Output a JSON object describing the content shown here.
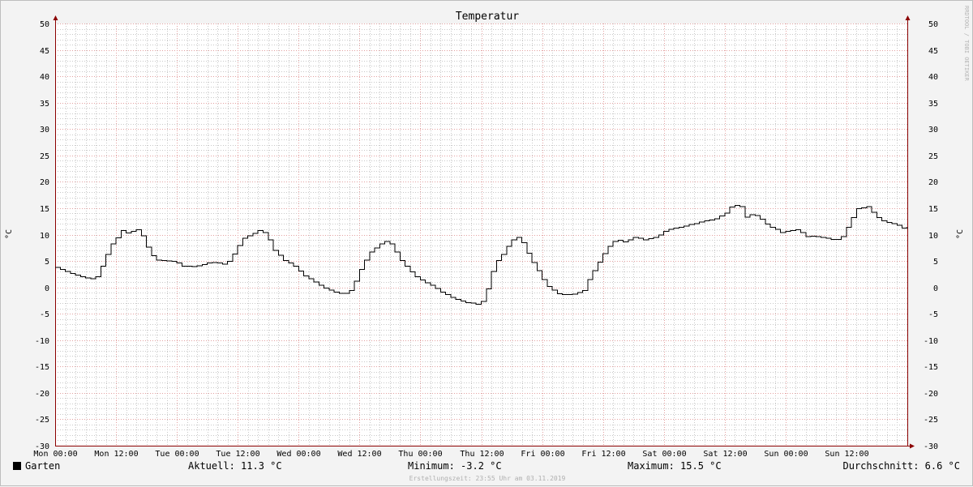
{
  "chart_data": {
    "type": "line",
    "title": "Temperatur",
    "ylabel": "°C",
    "ylabel_right": "°C",
    "watermark": "RRDTOOL / TOBI OETIKER",
    "ylim": [
      -30,
      50
    ],
    "yticks": [
      50,
      45,
      40,
      35,
      30,
      25,
      20,
      15,
      10,
      5,
      0,
      -5,
      -10,
      -15,
      -20,
      -25,
      -30
    ],
    "xlim_hours": [
      0,
      168
    ],
    "xticks": [
      {
        "label": "Mon 00:00",
        "hour": 0
      },
      {
        "label": "Mon 12:00",
        "hour": 12
      },
      {
        "label": "Tue 00:00",
        "hour": 24
      },
      {
        "label": "Tue 12:00",
        "hour": 36
      },
      {
        "label": "Wed 00:00",
        "hour": 48
      },
      {
        "label": "Wed 12:00",
        "hour": 60
      },
      {
        "label": "Thu 00:00",
        "hour": 72
      },
      {
        "label": "Thu 12:00",
        "hour": 84
      },
      {
        "label": "Fri 00:00",
        "hour": 96
      },
      {
        "label": "Fri 12:00",
        "hour": 108
      },
      {
        "label": "Sat 00:00",
        "hour": 120
      },
      {
        "label": "Sat 12:00",
        "hour": 132
      },
      {
        "label": "Sun 00:00",
        "hour": 144
      },
      {
        "label": "Sun 12:00",
        "hour": 156
      }
    ],
    "grid": true,
    "series": [
      {
        "name": "Garten",
        "color": "#000000",
        "points": [
          [
            0,
            3.8
          ],
          [
            1,
            3.4
          ],
          [
            2,
            3.0
          ],
          [
            3,
            2.6
          ],
          [
            4,
            2.3
          ],
          [
            5,
            2.0
          ],
          [
            6,
            1.8
          ],
          [
            7,
            1.6
          ],
          [
            8,
            2.0
          ],
          [
            9,
            4.0
          ],
          [
            10,
            6.2
          ],
          [
            11,
            8.2
          ],
          [
            12,
            9.4
          ],
          [
            13,
            10.8
          ],
          [
            14,
            10.3
          ],
          [
            15,
            10.6
          ],
          [
            16,
            10.9
          ],
          [
            17,
            9.8
          ],
          [
            18,
            7.6
          ],
          [
            19,
            6.0
          ],
          [
            20,
            5.2
          ],
          [
            21,
            5.1
          ],
          [
            22,
            5.0
          ],
          [
            23,
            4.9
          ],
          [
            24,
            4.6
          ],
          [
            25,
            4.0
          ],
          [
            26,
            4.0
          ],
          [
            27,
            3.9
          ],
          [
            28,
            4.1
          ],
          [
            29,
            4.3
          ],
          [
            30,
            4.6
          ],
          [
            31,
            4.7
          ],
          [
            32,
            4.6
          ],
          [
            33,
            4.4
          ],
          [
            34,
            4.9
          ],
          [
            35,
            6.3
          ],
          [
            36,
            7.9
          ],
          [
            37,
            9.3
          ],
          [
            38,
            9.8
          ],
          [
            39,
            10.2
          ],
          [
            40,
            10.8
          ],
          [
            41,
            10.4
          ],
          [
            42,
            9.0
          ],
          [
            43,
            7.0
          ],
          [
            44,
            6.1
          ],
          [
            45,
            5.1
          ],
          [
            46,
            4.6
          ],
          [
            47,
            4.0
          ],
          [
            48,
            3.1
          ],
          [
            49,
            2.2
          ],
          [
            50,
            1.6
          ],
          [
            51,
            1.0
          ],
          [
            52,
            0.4
          ],
          [
            53,
            -0.1
          ],
          [
            54,
            -0.5
          ],
          [
            55,
            -0.9
          ],
          [
            56,
            -1.1
          ],
          [
            57,
            -1.1
          ],
          [
            58,
            -0.6
          ],
          [
            59,
            1.2
          ],
          [
            60,
            3.4
          ],
          [
            61,
            5.2
          ],
          [
            62,
            6.7
          ],
          [
            63,
            7.5
          ],
          [
            64,
            8.2
          ],
          [
            65,
            8.7
          ],
          [
            66,
            8.2
          ],
          [
            67,
            6.7
          ],
          [
            68,
            5.1
          ],
          [
            69,
            4.0
          ],
          [
            70,
            2.9
          ],
          [
            71,
            2.0
          ],
          [
            72,
            1.4
          ],
          [
            73,
            0.9
          ],
          [
            74,
            0.4
          ],
          [
            75,
            -0.2
          ],
          [
            76,
            -0.9
          ],
          [
            77,
            -1.4
          ],
          [
            78,
            -1.9
          ],
          [
            79,
            -2.3
          ],
          [
            80,
            -2.6
          ],
          [
            81,
            -2.9
          ],
          [
            82,
            -3.0
          ],
          [
            83,
            -3.2
          ],
          [
            84,
            -2.7
          ],
          [
            85,
            -0.3
          ],
          [
            86,
            3.0
          ],
          [
            87,
            5.1
          ],
          [
            88,
            6.2
          ],
          [
            89,
            7.8
          ],
          [
            90,
            9.0
          ],
          [
            91,
            9.5
          ],
          [
            92,
            8.5
          ],
          [
            93,
            6.5
          ],
          [
            94,
            4.7
          ],
          [
            95,
            3.2
          ],
          [
            96,
            1.5
          ],
          [
            97,
            0.2
          ],
          [
            98,
            -0.5
          ],
          [
            99,
            -1.2
          ],
          [
            100,
            -1.4
          ],
          [
            101,
            -1.4
          ],
          [
            102,
            -1.3
          ],
          [
            103,
            -1.0
          ],
          [
            104,
            -0.6
          ],
          [
            105,
            1.5
          ],
          [
            106,
            3.2
          ],
          [
            107,
            4.8
          ],
          [
            108,
            6.4
          ],
          [
            109,
            7.8
          ],
          [
            110,
            8.7
          ],
          [
            111,
            8.9
          ],
          [
            112,
            8.6
          ],
          [
            113,
            9.0
          ],
          [
            114,
            9.5
          ],
          [
            115,
            9.3
          ],
          [
            116,
            9.0
          ],
          [
            117,
            9.2
          ],
          [
            118,
            9.5
          ],
          [
            119,
            9.9
          ],
          [
            120,
            10.6
          ],
          [
            121,
            11.0
          ],
          [
            122,
            11.2
          ],
          [
            123,
            11.4
          ],
          [
            124,
            11.6
          ],
          [
            125,
            11.9
          ],
          [
            126,
            12.1
          ],
          [
            127,
            12.4
          ],
          [
            128,
            12.6
          ],
          [
            129,
            12.8
          ],
          [
            130,
            13.0
          ],
          [
            131,
            13.5
          ],
          [
            132,
            14.1
          ],
          [
            133,
            15.2
          ],
          [
            134,
            15.5
          ],
          [
            135,
            15.3
          ],
          [
            136,
            13.3
          ],
          [
            137,
            13.8
          ],
          [
            138,
            13.6
          ],
          [
            139,
            12.9
          ],
          [
            140,
            12.0
          ],
          [
            141,
            11.4
          ],
          [
            142,
            11.0
          ],
          [
            143,
            10.4
          ],
          [
            144,
            10.6
          ],
          [
            145,
            10.8
          ],
          [
            146,
            10.9
          ],
          [
            147,
            10.4
          ],
          [
            148,
            9.6
          ],
          [
            149,
            9.7
          ],
          [
            150,
            9.6
          ],
          [
            151,
            9.5
          ],
          [
            152,
            9.3
          ],
          [
            153,
            9.1
          ],
          [
            154,
            9.1
          ],
          [
            155,
            9.6
          ],
          [
            156,
            11.4
          ],
          [
            157,
            13.2
          ],
          [
            158,
            14.9
          ],
          [
            159,
            15.1
          ],
          [
            160,
            15.3
          ],
          [
            161,
            14.2
          ],
          [
            162,
            13.2
          ],
          [
            163,
            12.6
          ],
          [
            164,
            12.3
          ],
          [
            165,
            12.1
          ],
          [
            166,
            11.8
          ],
          [
            167,
            11.2
          ],
          [
            168,
            11.3
          ]
        ]
      }
    ],
    "legend": {
      "series_label": "Garten",
      "aktuell": "Aktuell: 11.3 °C",
      "minimum": "Minimum: -3.2 °C",
      "maximum": "Maximum: 15.5 °C",
      "durchschnitt": "Durchschnitt: 6.6 °C"
    },
    "footer": "Erstellungszeit: 23:55 Uhr am 03.11.2019",
    "colors": {
      "background": "#f3f3f3",
      "plot_background": "#ffffff",
      "grid_minor": "#c8c8c8",
      "grid_major": "#e3a0a0",
      "axis": "#8b0000",
      "line": "#000000"
    }
  }
}
